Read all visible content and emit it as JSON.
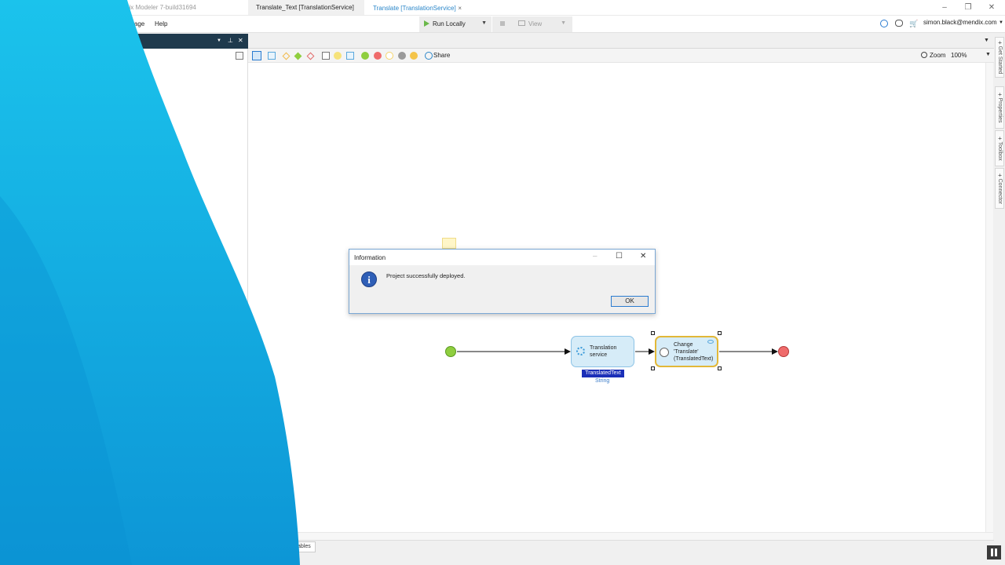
{
  "window": {
    "title": "dix Modeler 7-build31694"
  },
  "menu": {
    "items": [
      "guage",
      "Help"
    ],
    "run_label": "Run Locally",
    "view_label": "View",
    "user": "simon.black@mendix.com"
  },
  "tabs": [
    {
      "label": "Translate_Text [TranslationService]"
    },
    {
      "label": "Translate [TranslationService]"
    }
  ],
  "toolbar": {
    "share_label": "Share",
    "zoom_label": "Zoom",
    "zoom_value": "100%"
  },
  "sidetabs": [
    "Get Started",
    "Properties",
    "Toolbox",
    "Connector"
  ],
  "bottom_tab": "ables",
  "dialog": {
    "title": "Information",
    "message": "Project successfully deployed.",
    "ok_label": "OK"
  },
  "microflow": {
    "activity1_label": "Translation service",
    "activity2_label": "Change 'Translate' (TranslatedText)",
    "variable_name": "TranslatedText",
    "variable_type": "String"
  },
  "colors": {
    "accent": "#2a86c9",
    "brand_overlay": "#18b7e6",
    "start": "#8fce3f",
    "end": "#ef6b6b"
  }
}
